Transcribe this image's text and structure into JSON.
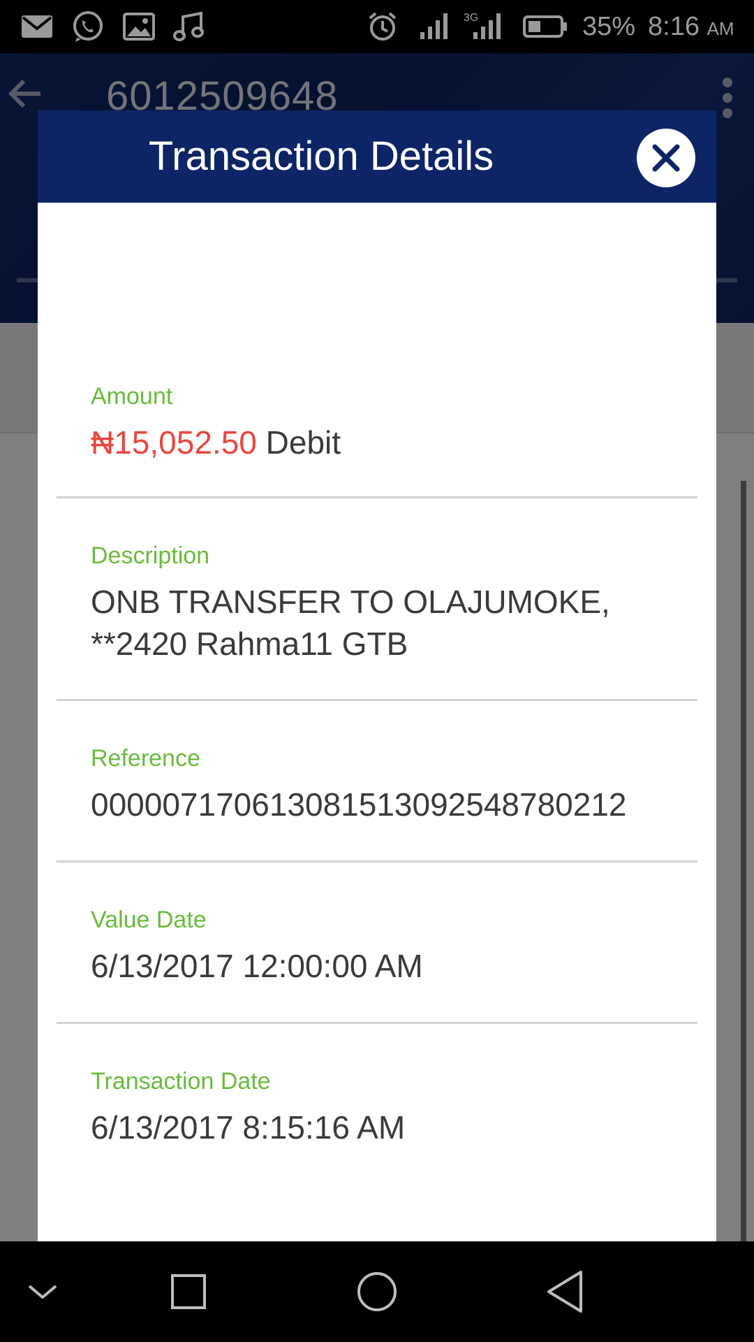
{
  "status_bar": {
    "battery": "35%",
    "time": "8:16",
    "ampm": "AM",
    "icons": [
      "mail-icon",
      "whatsapp-icon",
      "gallery-icon",
      "music-icon",
      "alarm-icon",
      "signal-icon",
      "signal-3g-icon",
      "battery-icon"
    ]
  },
  "app": {
    "account_number": "6012509648"
  },
  "dialog": {
    "title": "Transaction Details",
    "fields": {
      "amount": {
        "label": "Amount",
        "value": "₦15,052.50",
        "type": "Debit"
      },
      "description": {
        "label": "Description",
        "value": "ONB TRANSFER TO OLAJUMOKE, **2420 Rahma11 GTB"
      },
      "reference": {
        "label": "Reference",
        "value": "000007170613081513092548780212"
      },
      "value_date": {
        "label": "Value Date",
        "value": "6/13/2017 12:00:00 AM"
      },
      "transaction_date": {
        "label": "Transaction Date",
        "value": "6/13/2017 8:15:16 AM"
      }
    }
  },
  "colors": {
    "header_blue": "#0d2566",
    "label_green": "#6abb3c",
    "debit_red": "#e8473c"
  }
}
